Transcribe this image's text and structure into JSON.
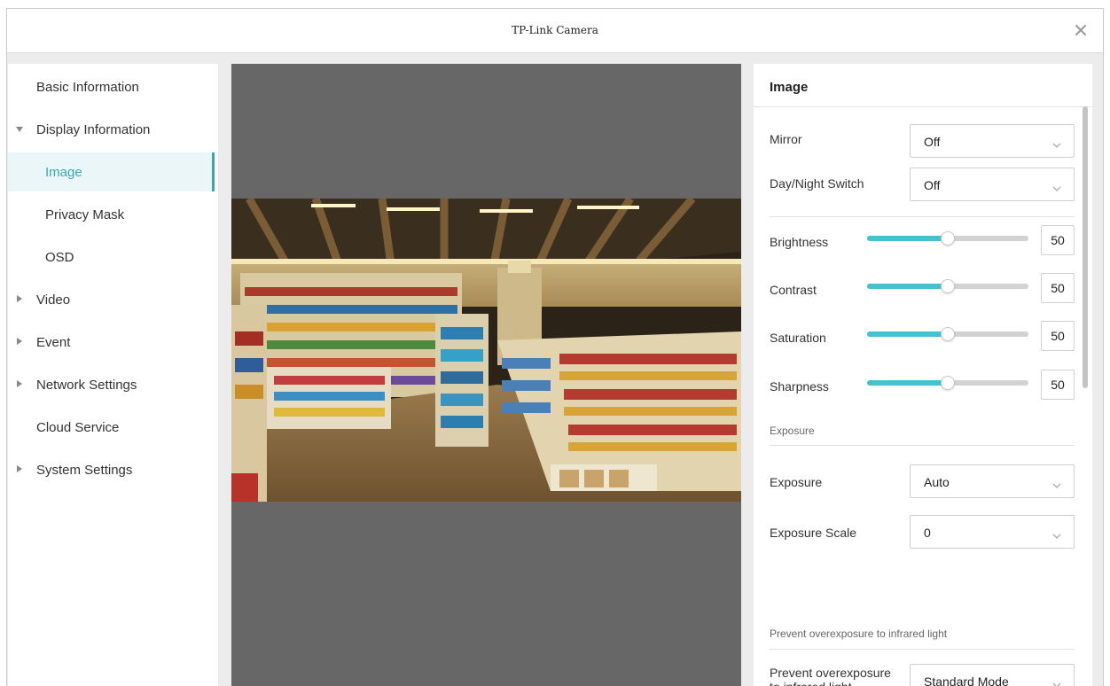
{
  "window": {
    "title": "TP-Link Camera"
  },
  "sidebar": {
    "items": [
      {
        "label": "Basic Information",
        "arrow": "none"
      },
      {
        "label": "Display Information",
        "arrow": "down"
      },
      {
        "label": "Image",
        "arrow": "none",
        "active": true,
        "sub": true
      },
      {
        "label": "Privacy Mask",
        "arrow": "none",
        "sub": true
      },
      {
        "label": "OSD",
        "arrow": "none",
        "sub": true
      },
      {
        "label": "Video",
        "arrow": "right"
      },
      {
        "label": "Event",
        "arrow": "right"
      },
      {
        "label": "Network Settings",
        "arrow": "right"
      },
      {
        "label": "Cloud Service",
        "arrow": "none"
      },
      {
        "label": "System Settings",
        "arrow": "right"
      }
    ]
  },
  "panel": {
    "title": "Image",
    "mirror": {
      "label": "Mirror",
      "value": "Off"
    },
    "day_night": {
      "label": "Day/Night Switch",
      "value": "Off"
    },
    "sliders": [
      {
        "label": "Brightness",
        "value": "50",
        "fraction": 0.5
      },
      {
        "label": "Contrast",
        "value": "50",
        "fraction": 0.5
      },
      {
        "label": "Saturation",
        "value": "50",
        "fraction": 0.5
      },
      {
        "label": "Sharpness",
        "value": "50",
        "fraction": 0.5
      }
    ],
    "exposure_section": "Exposure",
    "exposure": {
      "label": "Exposure",
      "value": "Auto"
    },
    "exposure_scale": {
      "label": "Exposure Scale",
      "value": "0"
    },
    "infrared_section": "Prevent overexposure to infrared light",
    "infrared": {
      "label": "Prevent overexposure to infrared light",
      "value": "Standard Mode"
    }
  },
  "colors": {
    "accent": "#3aa6b5",
    "slider_fill": "#43c3d2",
    "preview_bg": "#676767"
  }
}
